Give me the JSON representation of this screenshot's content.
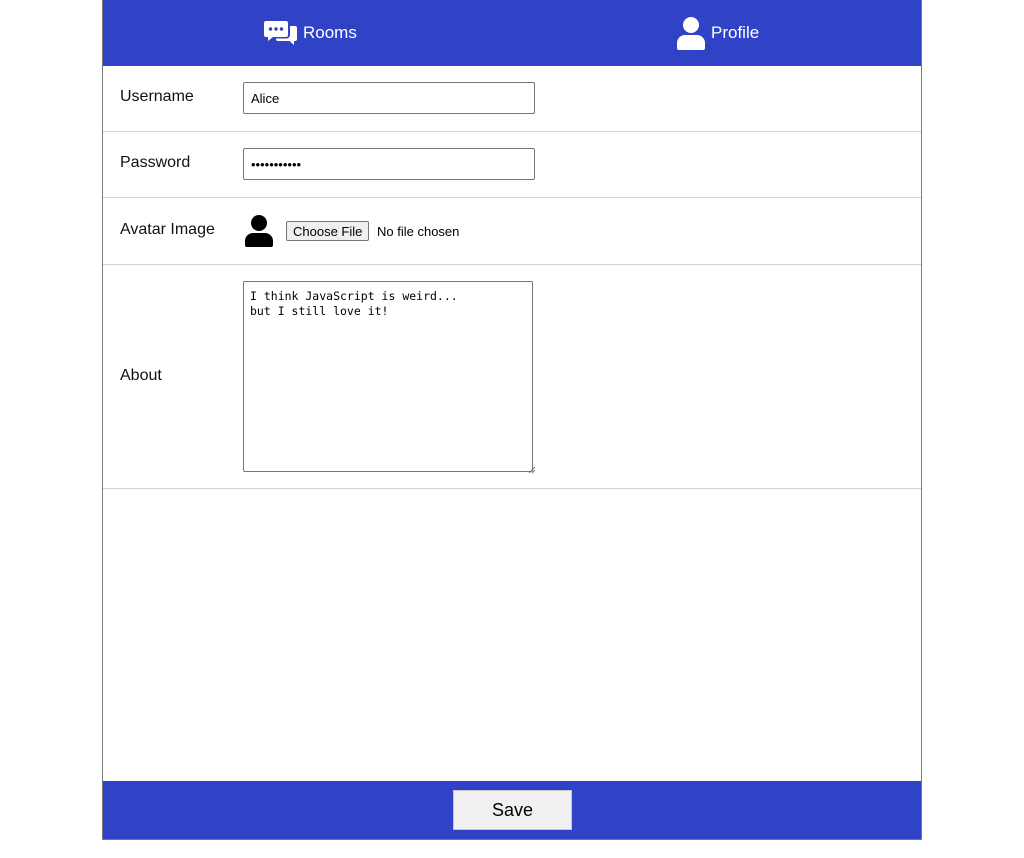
{
  "nav": {
    "rooms": {
      "label": "Rooms",
      "icon": "chat-bubbles-icon"
    },
    "profile": {
      "label": "Profile",
      "icon": "user-icon"
    }
  },
  "form": {
    "username": {
      "label": "Username",
      "value": "Alice"
    },
    "password": {
      "label": "Password",
      "value": "•••••••••••"
    },
    "avatar": {
      "label": "Avatar Image",
      "icon": "user-silhouette-icon",
      "button_label": "Choose File",
      "status": "No file chosen"
    },
    "about": {
      "label": "About",
      "value": "I think JavaScript is weird...\nbut I still love it!"
    }
  },
  "footer": {
    "save_label": "Save"
  },
  "colors": {
    "accent": "#3043c7",
    "button_bg": "#f0f0f0"
  }
}
